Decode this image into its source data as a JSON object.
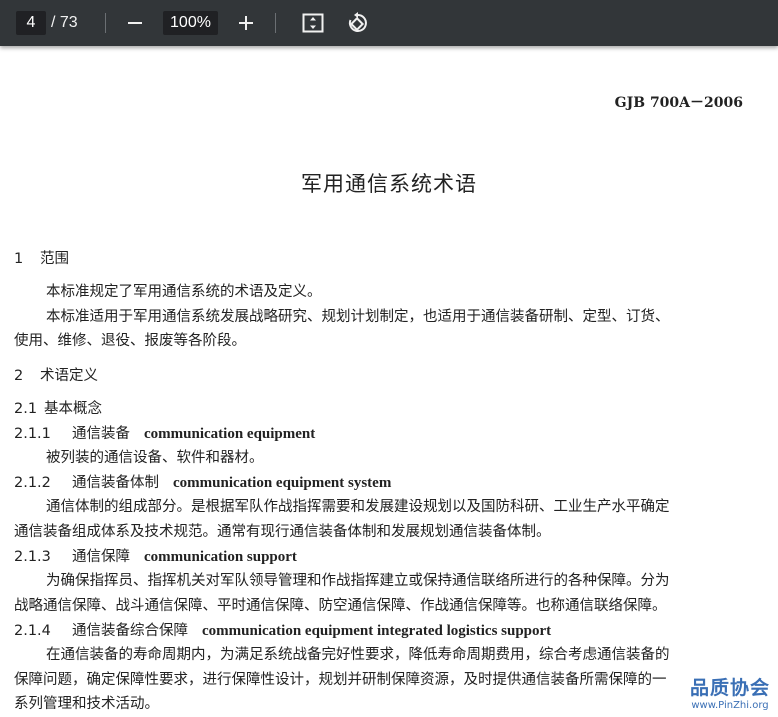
{
  "toolbar": {
    "page_current": "4",
    "page_total": "/ 73",
    "zoom_out_label": "—",
    "zoom_value": "100%",
    "zoom_in_label": "+",
    "fit_icon": "fit-page-icon",
    "rotate_icon": "rotate-icon"
  },
  "document": {
    "standard_code": "GJB 700A－2006",
    "title": "军用通信系统术语",
    "s1_num": "1",
    "s1_title": "范围",
    "s1_p1": "本标准规定了军用通信系统的术语及定义。",
    "s1_p2_a": "本标准适用于军用通信系统发展战略研究、规划计划制定，也适用于通信装备研制、定型、订货、",
    "s1_p2_b": "使用、维修、退役、报废等各阶段。",
    "s2_num": "2",
    "s2_title": "术语定义",
    "s21_num": "2.1",
    "s21_title": "基本概念",
    "t211_num": "2.1.1",
    "t211_cn": "通信装备",
    "t211_en": "communication equipment",
    "t211_def": "被列装的通信设备、软件和器材。",
    "t212_num": "2.1.2",
    "t212_cn": "通信装备体制",
    "t212_en": "communication equipment system",
    "t212_def_a": "通信体制的组成部分。是根据军队作战指挥需要和发展建设规划以及国防科研、工业生产水平确定",
    "t212_def_b": "通信装备组成体系及技术规范。通常有现行通信装备体制和发展规划通信装备体制。",
    "t213_num": "2.1.3",
    "t213_cn": "通信保障",
    "t213_en": "communication support",
    "t213_def_a": "为确保指挥员、指挥机关对军队领导管理和作战指挥建立或保持通信联络所进行的各种保障。分为",
    "t213_def_b": "战略通信保障、战斗通信保障、平时通信保障、防空通信保障、作战通信保障等。也称通信联络保障。",
    "t214_num": "2.1.4",
    "t214_cn": "通信装备综合保障",
    "t214_en": "communication equipment integrated logistics support",
    "t214_def_a": "在通信装备的寿命周期内，为满足系统战备完好性要求，降低寿命周期费用，综合考虑通信装备的",
    "t214_def_b": "保障问题，确定保障性要求，进行保障性设计，规划并研制保障资源，及时提供通信装备所需保障的一",
    "t214_def_c": "系列管理和技术活动。"
  },
  "watermark": {
    "text_cn": "品质协会",
    "url": "www.PinZhi.org"
  }
}
